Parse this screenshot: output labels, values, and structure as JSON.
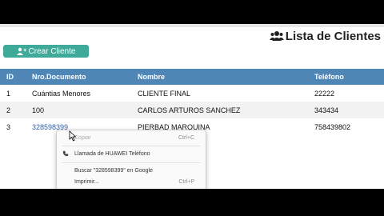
{
  "header": {
    "title": "Lista de Clientes",
    "title_icon": "users-icon"
  },
  "toolbar": {
    "create_label": "Crear Cliente",
    "create_icon": "user-plus-icon"
  },
  "table": {
    "columns": [
      "ID",
      "Nro.Documento",
      "Nombre",
      "Teléfono"
    ],
    "rows": [
      {
        "id": "1",
        "doc": "Cuántias Menores",
        "name": "CLIENTE FINAL",
        "tel": "22222"
      },
      {
        "id": "2",
        "doc": "100",
        "name": "CARLOS ARTUROS SANCHEZ",
        "tel": "343434"
      },
      {
        "id": "3",
        "doc": "328598399",
        "name": "PIERBAD MARQUINA",
        "tel": "758439802"
      }
    ]
  },
  "context_menu": {
    "copy_label": "Copiar",
    "copy_shortcut": "Ctrl+C",
    "call_label": "Llamada de HUAWEI Teléfono",
    "call_icon": "phone-icon",
    "search_label": "Buscar \"328598399\" en Google",
    "print_label": "Imprimir...",
    "print_shortcut": "Ctrl+P"
  },
  "colors": {
    "header_bg": "#4f86b6",
    "button_bg": "#3fa99a",
    "link": "#2b5fa8",
    "letterbox": "#000000"
  }
}
